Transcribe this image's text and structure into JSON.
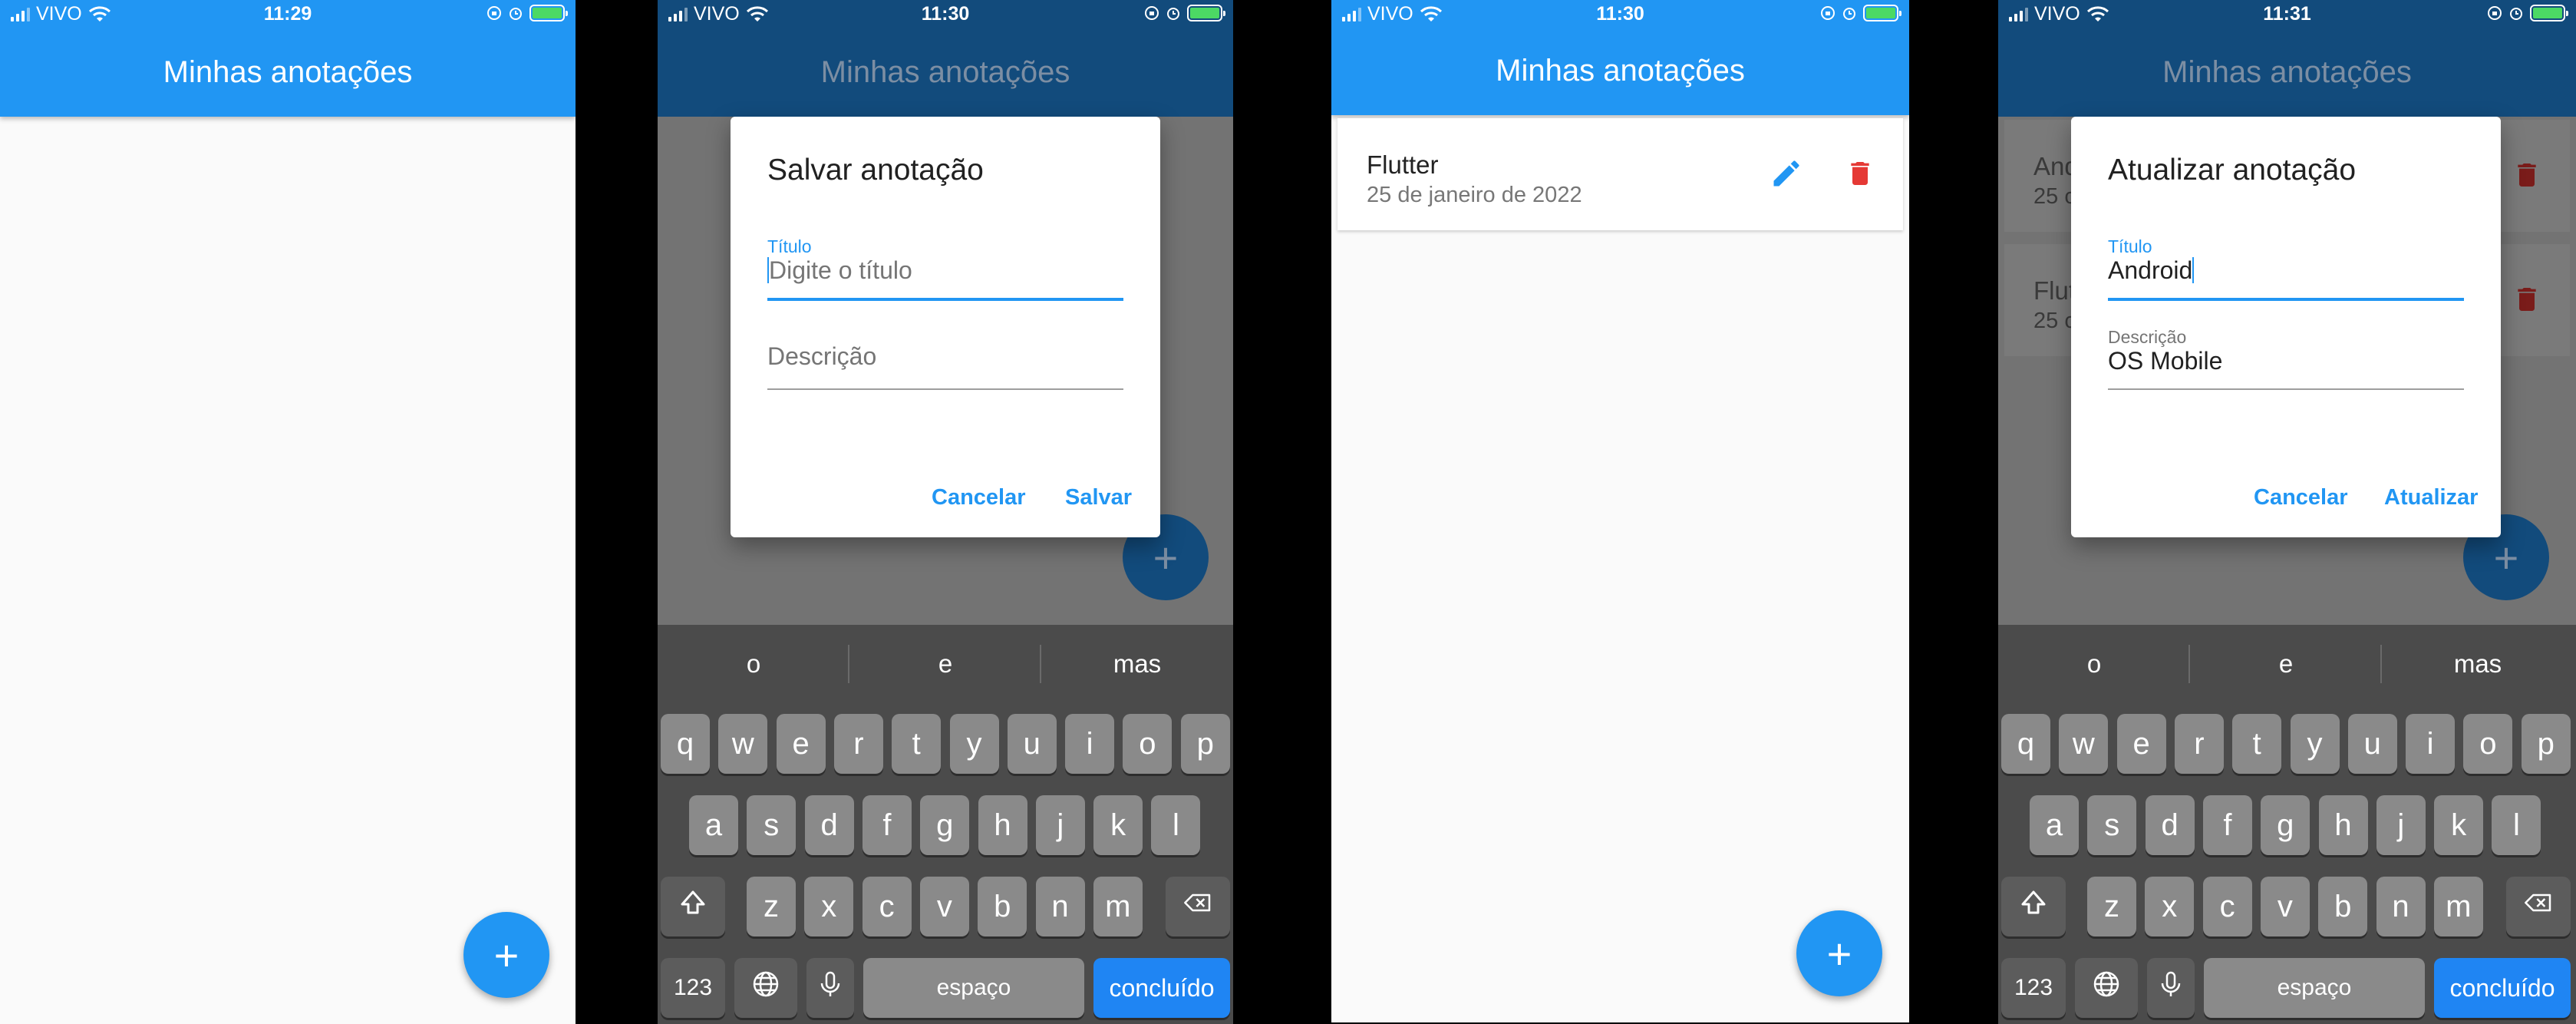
{
  "status_bar": {
    "carrier": "VIVO",
    "times": [
      "11:29",
      "11:30",
      "11:30",
      "11:31"
    ]
  },
  "app_title": "Minhas anotações",
  "colors": {
    "primary": "#2196f3",
    "delete": "#e53935",
    "keyboard_go": "#1f85f3"
  },
  "fab_label": "+",
  "save_dialog": {
    "title": "Salvar anotação",
    "title_field": {
      "label": "Título",
      "placeholder": "Digite o título"
    },
    "desc_field": {
      "placeholder": "Descrição"
    },
    "cancel_label": "Cancelar",
    "save_label": "Salvar"
  },
  "notes_list": [
    {
      "title": "Flutter",
      "date": "25 de janeiro de 2022"
    }
  ],
  "background_notes": [
    {
      "title_partial": "And",
      "date_partial": "25 c"
    },
    {
      "title_partial": "Flut",
      "date_partial": "25 c"
    }
  ],
  "update_dialog": {
    "title": "Atualizar anotação",
    "title_field": {
      "label": "Título",
      "value": "Android"
    },
    "desc_field": {
      "label": "Descrição",
      "value": "OS Mobile"
    },
    "cancel_label": "Cancelar",
    "update_label": "Atualizar"
  },
  "keyboard": {
    "suggestions": [
      "o",
      "e",
      "mas"
    ],
    "row1": [
      "q",
      "w",
      "e",
      "r",
      "t",
      "y",
      "u",
      "i",
      "o",
      "p"
    ],
    "row2": [
      "a",
      "s",
      "d",
      "f",
      "g",
      "h",
      "j",
      "k",
      "l"
    ],
    "row3": [
      "z",
      "x",
      "c",
      "v",
      "b",
      "n",
      "m"
    ],
    "numbers_label": "123",
    "space_label": "espaço",
    "done_label": "concluído"
  }
}
